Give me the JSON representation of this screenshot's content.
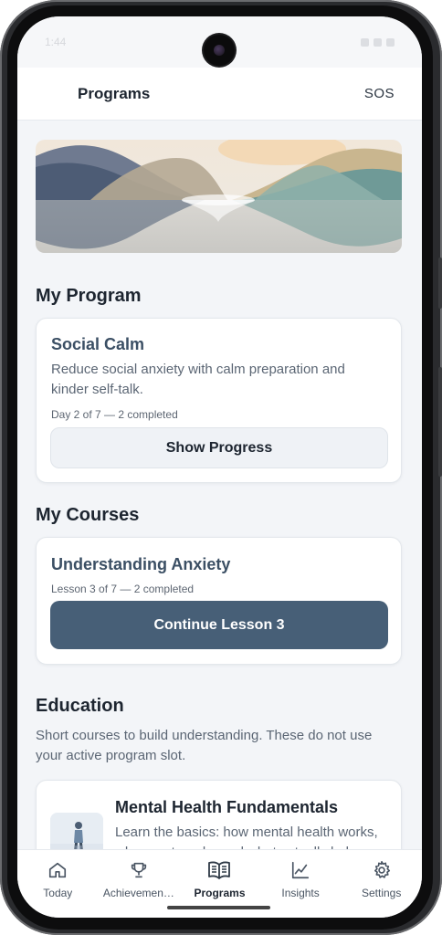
{
  "status_bar": {
    "time": "1:44"
  },
  "header": {
    "title": "Programs",
    "sos_label": "SOS"
  },
  "my_program": {
    "section_title": "My Program",
    "card": {
      "title": "Social Calm",
      "description": "Reduce social anxiety with calm preparation and kinder self-talk.",
      "progress_text": "Day 2 of 7 — 2 completed",
      "button_label": "Show Progress"
    }
  },
  "my_courses": {
    "section_title": "My Courses",
    "card": {
      "title": "Understanding Anxiety",
      "progress_text": "Lesson 3 of 7 — 2 completed",
      "button_label": "Continue Lesson 3"
    }
  },
  "education": {
    "section_title": "Education",
    "intro": "Short courses to build understanding. These do not use your active program slot.",
    "courses": [
      {
        "title": "Mental Health Fundamentals",
        "description": "Learn the basics: how mental health works, why we struggle, and what actually helps."
      }
    ]
  },
  "tab_bar": {
    "tabs": [
      {
        "label": "Today",
        "icon": "home-icon"
      },
      {
        "label": "Achievemen…",
        "icon": "trophy-icon"
      },
      {
        "label": "Programs",
        "icon": "book-icon",
        "active": true
      },
      {
        "label": "Insights",
        "icon": "chart-line-icon"
      },
      {
        "label": "Settings",
        "icon": "gear-icon"
      }
    ]
  },
  "colors": {
    "primary_button": "#475f77",
    "card_title": "#3b4f64",
    "background": "#f3f5f8"
  }
}
